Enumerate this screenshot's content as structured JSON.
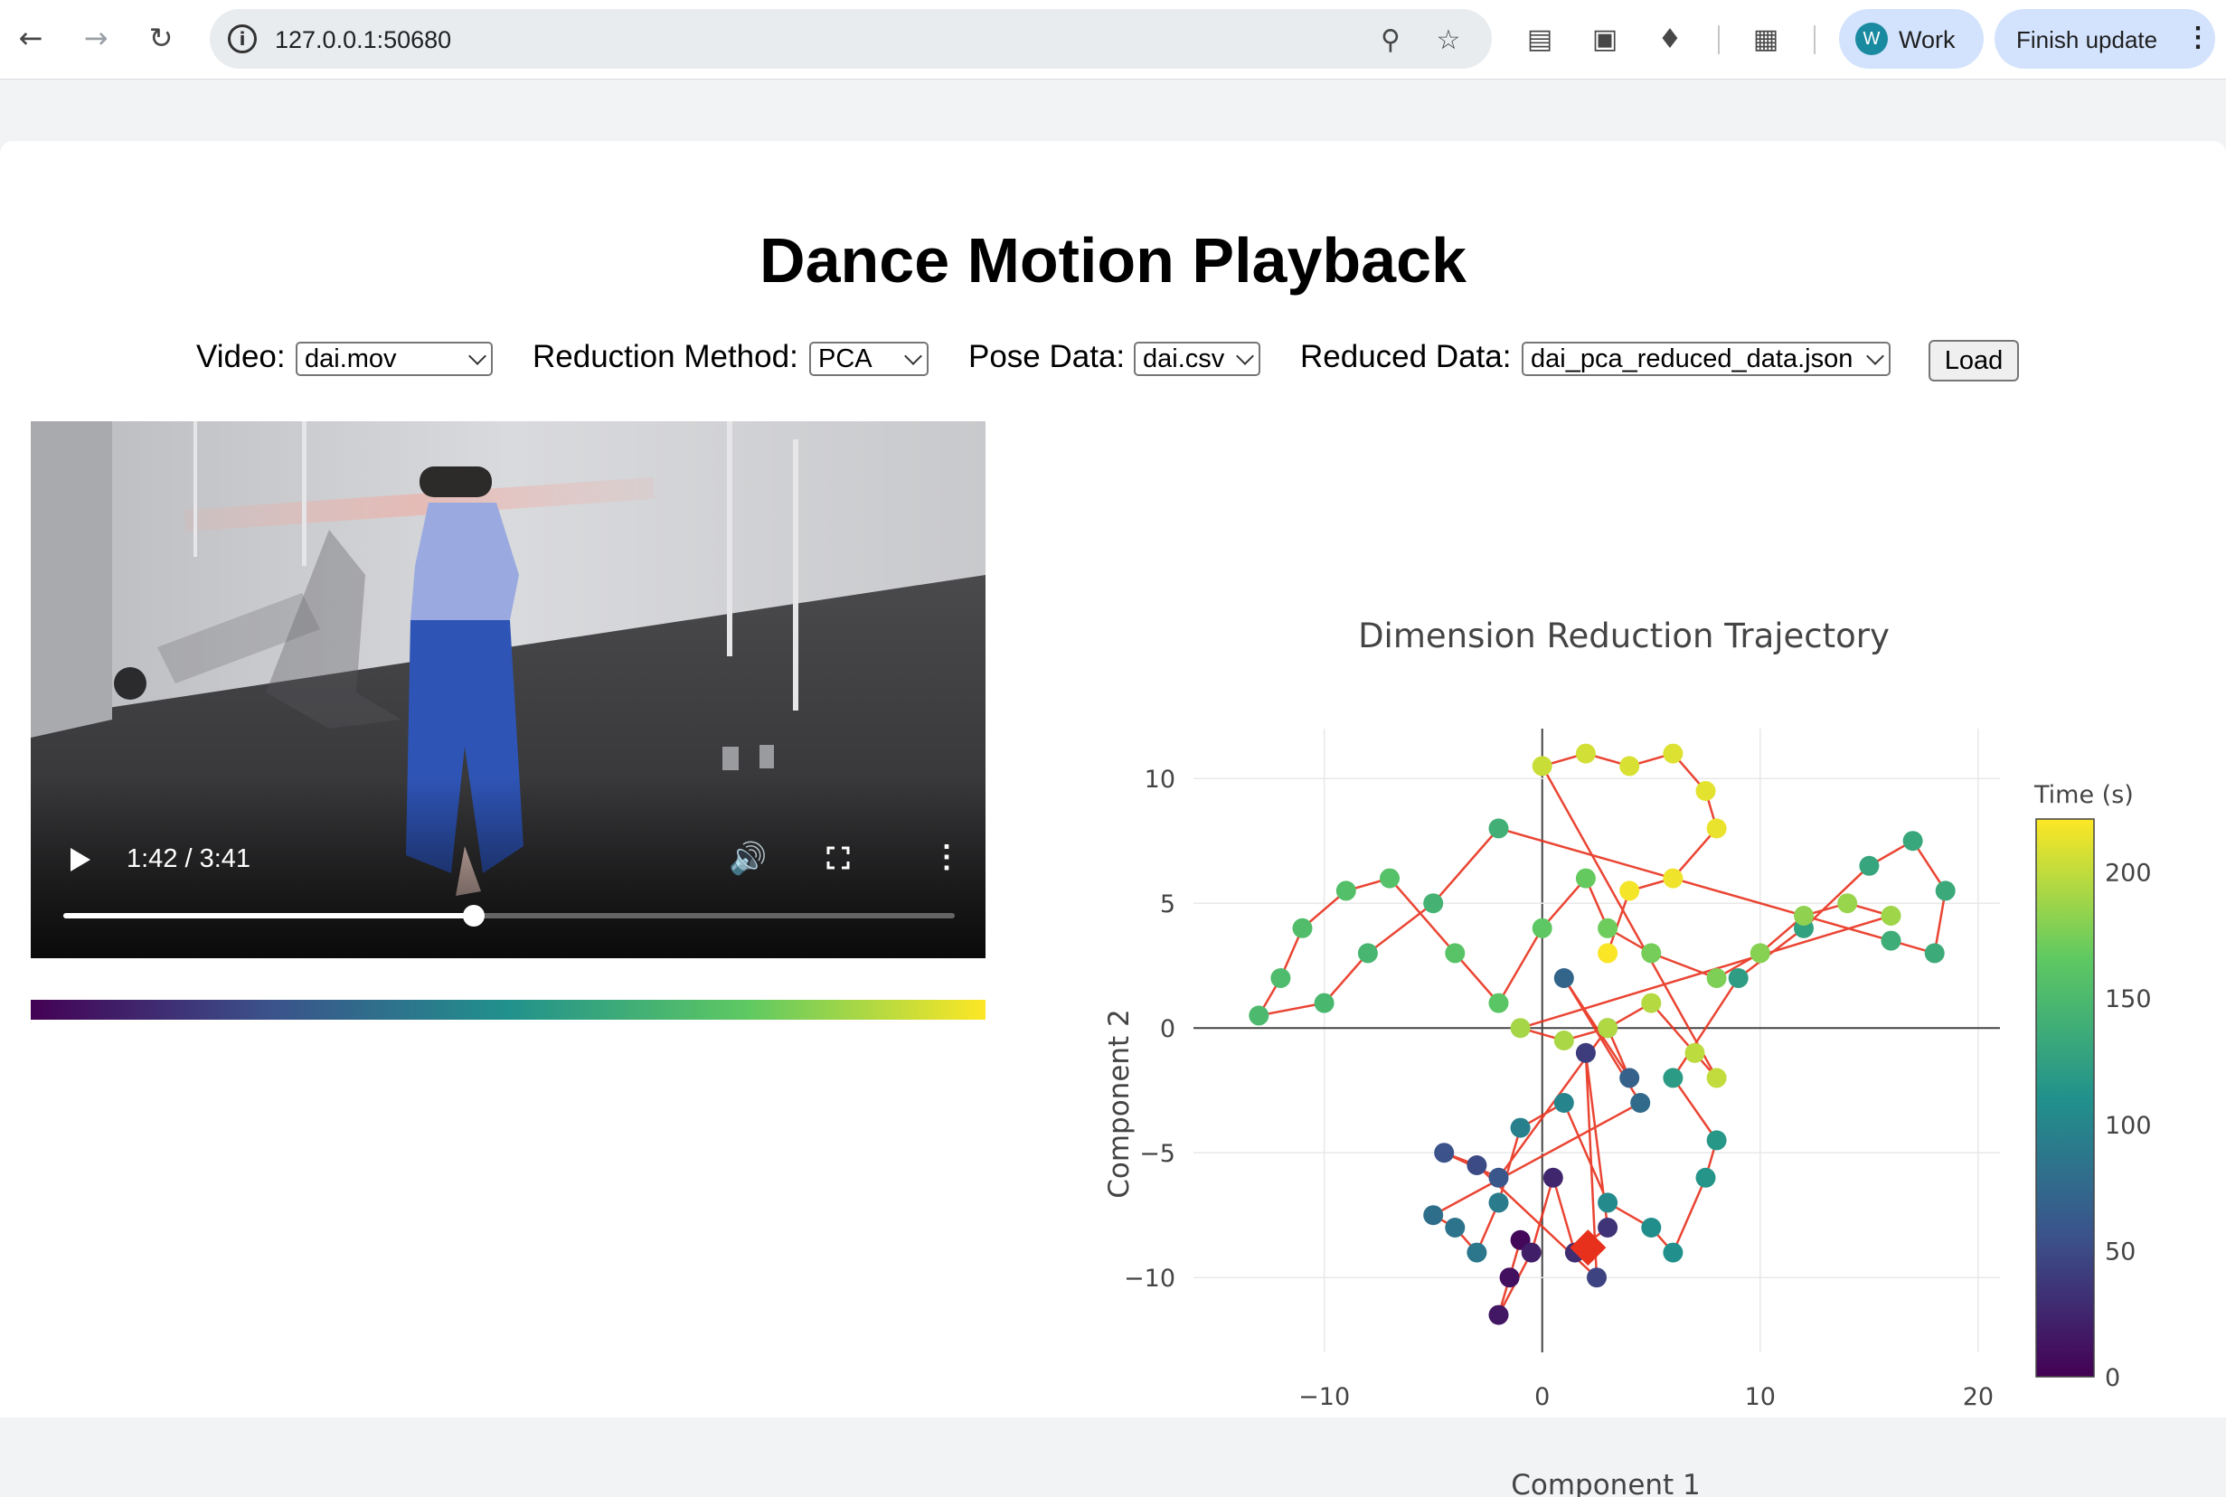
{
  "browser": {
    "url": "127.0.0.1:50680",
    "profile_initial": "W",
    "profile_label": "Work",
    "update_label": "Finish update"
  },
  "page": {
    "title": "Dance Motion Playback",
    "controls": {
      "video_label": "Video:",
      "video_value": "dai.mov",
      "method_label": "Reduction Method:",
      "method_value": "PCA",
      "pose_label": "Pose Data:",
      "pose_value": "dai.csv",
      "reduced_label": "Reduced Data:",
      "reduced_value": "dai_pca_reduced_data.json",
      "load_label": "Load"
    },
    "video": {
      "time_display": "1:42 / 3:41",
      "progress_fraction": 0.46
    }
  },
  "chart_data": {
    "type": "scatter",
    "title": "Dimension Reduction Trajectory",
    "xlabel": "Component 1",
    "ylabel": "Component 2",
    "xlim": [
      -16,
      21
    ],
    "ylim": [
      -13,
      12
    ],
    "x_ticks": [
      -10,
      0,
      10,
      20
    ],
    "x_tick_labels": [
      "−10",
      "0",
      "10",
      "20"
    ],
    "y_ticks": [
      10,
      5,
      0,
      -5,
      -10
    ],
    "y_tick_labels": [
      "10",
      "5",
      "0",
      "−5",
      "−10"
    ],
    "colorbar": {
      "title": "Time (s)",
      "range": [
        0,
        221
      ],
      "ticks": [
        0,
        50,
        100,
        150,
        200
      ],
      "tick_labels": [
        "0",
        "50",
        "100",
        "150",
        "200"
      ],
      "colorscale": [
        "#440154",
        "#3b528b",
        "#21918c",
        "#5ec962",
        "#fde725"
      ]
    },
    "current_marker": {
      "x": 2.1,
      "y": -8.8,
      "color": "#e8311d"
    },
    "line_color": "#e8311d",
    "grid": true,
    "points": [
      [
        -1,
        -8.5,
        5
      ],
      [
        -1.5,
        -10,
        10
      ],
      [
        -2,
        -11.5,
        15
      ],
      [
        -0.5,
        -9,
        20
      ],
      [
        0.5,
        -6,
        25
      ],
      [
        1.5,
        -9,
        30
      ],
      [
        3,
        -8,
        35
      ],
      [
        2,
        -1,
        40
      ],
      [
        2.5,
        -10,
        45
      ],
      [
        -3,
        -5.5,
        50
      ],
      [
        -4.5,
        -5,
        55
      ],
      [
        -2,
        -6,
        60
      ],
      [
        3,
        0,
        64
      ],
      [
        4,
        -2,
        68
      ],
      [
        1,
        2,
        72
      ],
      [
        4.5,
        -3,
        76
      ],
      [
        -5,
        -7.5,
        80
      ],
      [
        -4,
        -8,
        84
      ],
      [
        -3,
        -9,
        88
      ],
      [
        -2,
        -7,
        92
      ],
      [
        -1,
        -4,
        96
      ],
      [
        1,
        -3,
        100
      ],
      [
        3,
        -7,
        104
      ],
      [
        5,
        -8,
        108
      ],
      [
        6,
        -9,
        110
      ],
      [
        7.5,
        -6,
        114
      ],
      [
        8,
        -4.5,
        116
      ],
      [
        6,
        -2,
        120
      ],
      [
        9,
        2,
        122
      ],
      [
        12,
        4,
        126
      ],
      [
        15,
        6.5,
        130
      ],
      [
        17,
        7.5,
        132
      ],
      [
        18.5,
        5.5,
        134
      ],
      [
        18,
        3,
        136
      ],
      [
        16,
        3.5,
        138
      ],
      [
        -2,
        8,
        140
      ],
      [
        -5,
        5,
        143
      ],
      [
        -8,
        3,
        146
      ],
      [
        -10,
        1,
        148
      ],
      [
        -13,
        0.5,
        150
      ],
      [
        -12,
        2,
        152
      ],
      [
        -11,
        4,
        154
      ],
      [
        -9,
        5.5,
        156
      ],
      [
        -7,
        6,
        158
      ],
      [
        -4,
        3,
        160
      ],
      [
        -2,
        1,
        162
      ],
      [
        0,
        4,
        165
      ],
      [
        2,
        6,
        168
      ],
      [
        3,
        4,
        171
      ],
      [
        5,
        3,
        174
      ],
      [
        8,
        2,
        177
      ],
      [
        10,
        3,
        180
      ],
      [
        12,
        4.5,
        183
      ],
      [
        14,
        5,
        186
      ],
      [
        16,
        4.5,
        188
      ],
      [
        -1,
        0,
        190
      ],
      [
        1,
        -0.5,
        192
      ],
      [
        3,
        0,
        194
      ],
      [
        5,
        1,
        196
      ],
      [
        7,
        -1,
        198
      ],
      [
        8,
        -2,
        200
      ],
      [
        0,
        10.5,
        203
      ],
      [
        2,
        11,
        206
      ],
      [
        4,
        10.5,
        208
      ],
      [
        6,
        11,
        210
      ],
      [
        7.5,
        9.5,
        212
      ],
      [
        8,
        8,
        214
      ],
      [
        6,
        6,
        216
      ],
      [
        4,
        5.5,
        218
      ],
      [
        3,
        3,
        220
      ]
    ]
  }
}
